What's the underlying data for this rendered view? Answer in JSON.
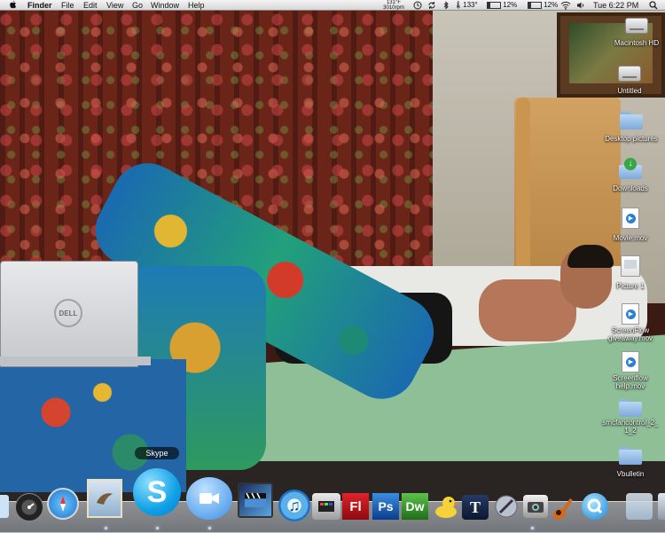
{
  "menubar": {
    "app_name": "Finder",
    "menus": [
      "File",
      "Edit",
      "View",
      "Go",
      "Window",
      "Help"
    ],
    "temperature": "131°F",
    "fan_speed": "3010rpm",
    "cpu_temp": "133°",
    "battery_1": "12%",
    "battery_2": "12%",
    "clock": "Tue 6:22 PM"
  },
  "desktop_icons": [
    {
      "label": "Macintosh HD",
      "icon": "hard-drive-icon"
    },
    {
      "label": "Untitled",
      "icon": "hard-drive-icon"
    },
    {
      "label": "Desktop pictures",
      "icon": "folder-icon"
    },
    {
      "label": "Downloads",
      "icon": "downloads-folder-icon"
    },
    {
      "label": "Movie.mov",
      "icon": "movie-file-icon"
    },
    {
      "label": "Picture 1",
      "icon": "picture-file-icon"
    },
    {
      "label": "ScreenFlow\ngiveaway.mov",
      "icon": "movie-file-icon"
    },
    {
      "label": "Screenflow\nhelp.mov",
      "icon": "movie-file-icon"
    },
    {
      "label": "smcfancontrol_2_\n1_2",
      "icon": "folder-icon"
    },
    {
      "label": "Vbulletin",
      "icon": "folder-icon"
    }
  ],
  "laptop_logo": "DELL",
  "dock": {
    "tooltip": "Skype",
    "items": [
      {
        "name": "finder-icon",
        "glyph": ""
      },
      {
        "name": "dashboard-icon",
        "glyph": ""
      },
      {
        "name": "safari-icon",
        "glyph": ""
      },
      {
        "name": "mail-icon",
        "glyph": ""
      },
      {
        "name": "skype-icon",
        "glyph": "S"
      },
      {
        "name": "ichat-icon",
        "glyph": ""
      },
      {
        "name": "imovie-icon",
        "glyph": ""
      },
      {
        "name": "itunes-icon",
        "glyph": "♫"
      },
      {
        "name": "dvd-icon",
        "glyph": ""
      },
      {
        "name": "flash-icon",
        "glyph": "Fl"
      },
      {
        "name": "photoshop-icon",
        "glyph": "Ps"
      },
      {
        "name": "dreamweaver-icon",
        "glyph": "Dw"
      },
      {
        "name": "cyberduck-icon",
        "glyph": ""
      },
      {
        "name": "textedit-icon",
        "glyph": "T"
      },
      {
        "name": "utility-icon",
        "glyph": ""
      },
      {
        "name": "image-capture-icon",
        "glyph": ""
      },
      {
        "name": "garageband-icon",
        "glyph": ""
      },
      {
        "name": "quicktime-icon",
        "glyph": ""
      },
      {
        "name": "stack-icon",
        "glyph": ""
      },
      {
        "name": "trash-icon",
        "glyph": ""
      }
    ]
  }
}
